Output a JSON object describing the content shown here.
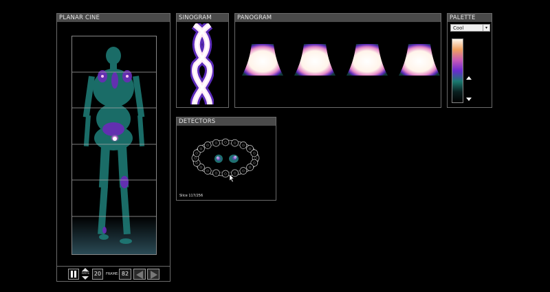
{
  "panels": {
    "planar": {
      "title": "PLANAR CINE"
    },
    "sinogram": {
      "title": "SINOGRAM"
    },
    "panogram": {
      "title": "PANOGRAM"
    },
    "palette": {
      "title": "PALETTE"
    },
    "detectors": {
      "title": "DETECTORS"
    }
  },
  "controls": {
    "rate_label": "RATE",
    "rate_value": "20",
    "frame_label": "FRAME:",
    "frame_value": "82"
  },
  "palette": {
    "selected": "Cool",
    "gradient": [
      "#fff8ee",
      "#f0a060",
      "#c85ab8",
      "#6a2bd0",
      "#1a7a70",
      "#0a2020",
      "#000000"
    ]
  },
  "detectors": {
    "slice_text": "Slice 117/256"
  },
  "colors": {
    "panel_border": "#6b6b6b",
    "title_bar": "#4a4a4a",
    "background": "#000000"
  }
}
